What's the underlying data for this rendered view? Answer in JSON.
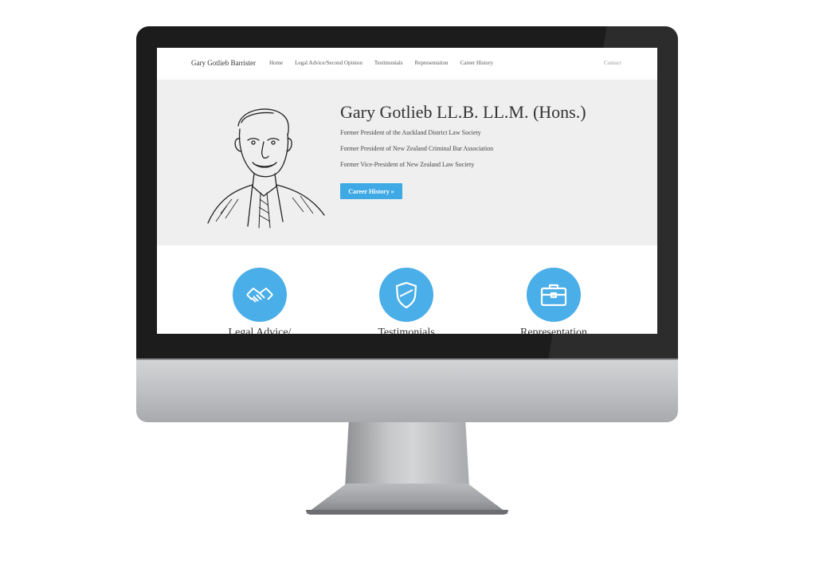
{
  "nav": {
    "brand": "Gary Gotlieb Barrister",
    "links": [
      "Home",
      "Legal Advice/Second Opinion",
      "Testimonials",
      "Representation",
      "Career History"
    ],
    "contact": "Contact"
  },
  "hero": {
    "title": "Gary Gotlieb LL.B. LL.M. (Hons.)",
    "lines": [
      "Former President of the Auckland District Law Society",
      "Former President of New Zealand Criminal Bar Association",
      "Former Vice-President of New Zealand Law Society"
    ],
    "button": "Career History »"
  },
  "services": [
    {
      "icon": "handshake-icon",
      "label": "Legal Advice/"
    },
    {
      "icon": "shield-icon",
      "label": "Testimonials"
    },
    {
      "icon": "briefcase-icon",
      "label": "Representation"
    }
  ],
  "colors": {
    "accent": "#3ea9e5",
    "bezel": "#1c1c1c",
    "hero_bg": "#efefef"
  }
}
